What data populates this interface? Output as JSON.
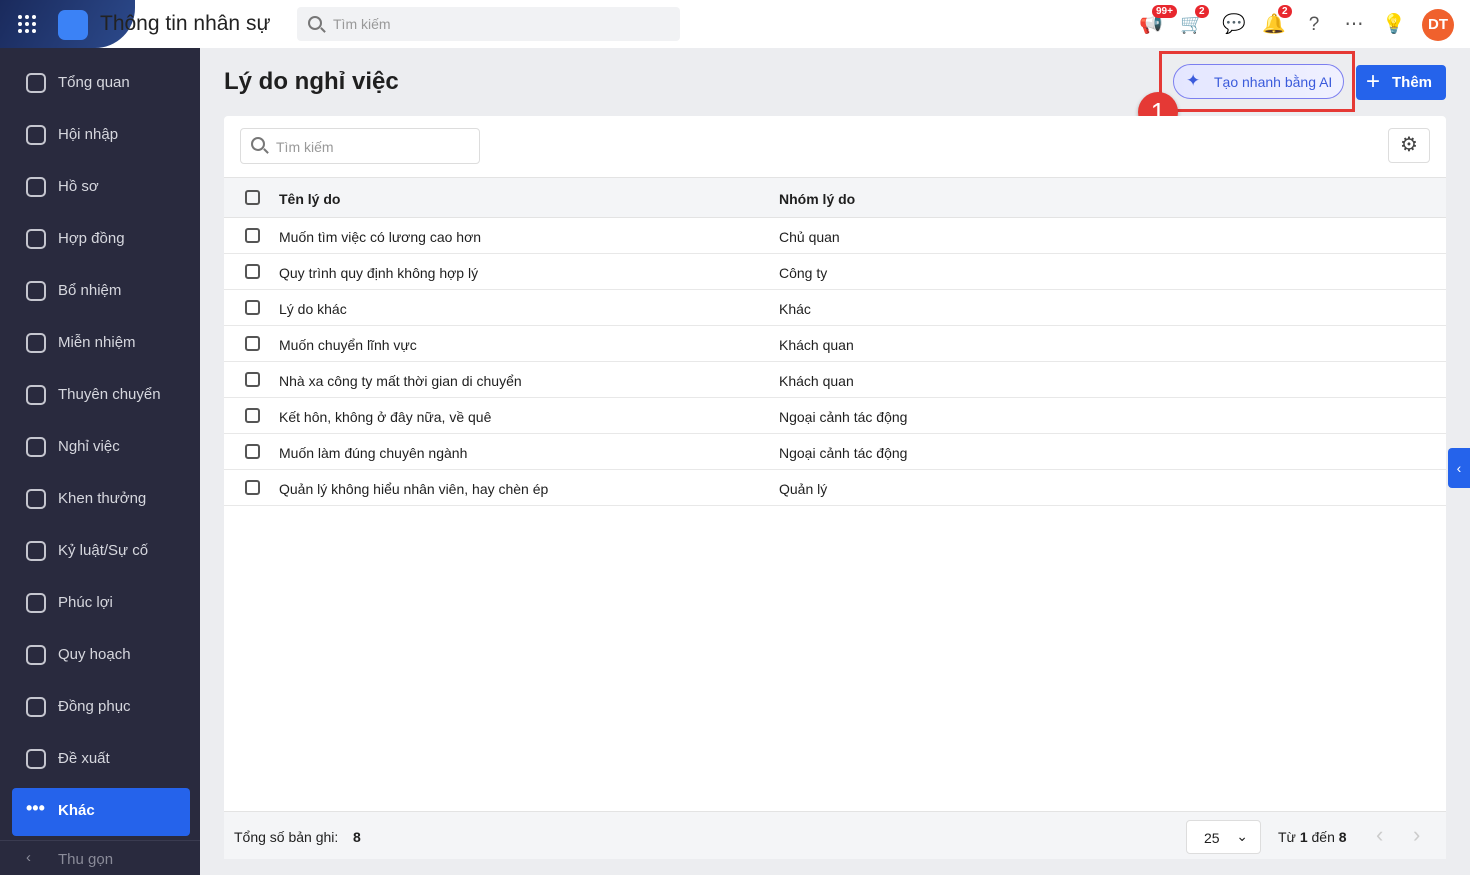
{
  "header": {
    "app_title": "Thông tin nhân sự",
    "search_placeholder": "Tìm kiếm",
    "badges": {
      "announcements": "99+",
      "cart": "2",
      "notifications": "2"
    },
    "avatar_initials": "DT"
  },
  "sidebar": {
    "items": [
      {
        "label": "Tổng quan"
      },
      {
        "label": "Hội nhập"
      },
      {
        "label": "Hồ sơ"
      },
      {
        "label": "Hợp đồng"
      },
      {
        "label": "Bổ nhiệm"
      },
      {
        "label": "Miễn nhiệm"
      },
      {
        "label": "Thuyên chuyển"
      },
      {
        "label": "Nghỉ việc"
      },
      {
        "label": "Khen thưởng"
      },
      {
        "label": "Kỷ luật/Sự cố"
      },
      {
        "label": "Phúc lợi"
      },
      {
        "label": "Quy hoạch"
      },
      {
        "label": "Đồng phục"
      },
      {
        "label": "Đề xuất"
      },
      {
        "label": "Khác"
      }
    ],
    "active": "Khác",
    "collapse_label": "Thu gọn"
  },
  "main": {
    "title": "Lý do nghỉ việc",
    "ai_button": "Tạo nhanh bằng AI",
    "add_button": "Thêm",
    "step_marker": "1",
    "search_placeholder": "Tìm kiếm",
    "columns": [
      "Tên lý do",
      "Nhóm lý do"
    ],
    "rows": [
      [
        "Muốn tìm việc có lương cao hơn",
        "Chủ quan"
      ],
      [
        "Quy trình quy định không hợp lý",
        "Công ty"
      ],
      [
        "Lý do khác",
        "Khác"
      ],
      [
        "Muốn chuyển lĩnh vực",
        "Khách quan"
      ],
      [
        "Nhà xa công ty mất thời gian di chuyển",
        "Khách quan"
      ],
      [
        "Kết hôn, không ở đây nữa, về quê",
        "Ngoại cảnh tác động"
      ],
      [
        "Muốn làm đúng chuyên ngành",
        "Ngoại cảnh tác động"
      ],
      [
        "Quản lý không hiểu nhân viên, hay chèn ép",
        "Quản lý"
      ]
    ],
    "footer": {
      "total_label": "Tổng số bản ghi:",
      "total": "8",
      "page_size": "25",
      "range_from_label": "Từ",
      "range_from": "1",
      "range_to_label": "đến",
      "range_to": "8"
    }
  },
  "colors": {
    "accent": "#2563eb",
    "sidebar": "#292a3e",
    "highlight": "#e53935"
  }
}
